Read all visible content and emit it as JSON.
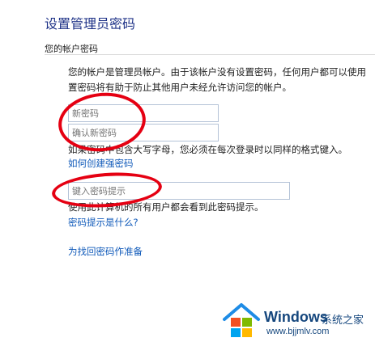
{
  "page": {
    "title": "设置管理员密码",
    "section_label": "您的帐户密码",
    "description": "您的帐户是管理员帐户。由于该帐户没有设置密码，任何用户都可以使用置密码将有助于防止其他用户未经允许访问您的帐户。"
  },
  "form": {
    "new_password_placeholder": "新密码",
    "confirm_password_placeholder": "确认新密码",
    "case_note": "如果密码中包含大写字母，您必须在每次登录时以同样的格式键入。",
    "strong_password_link": "如何创建强密码",
    "hint_placeholder": "键入密码提示",
    "hint_note": "使用此计算机的所有用户都会看到此密码提示。",
    "hint_link": "密码提示是什么?",
    "reset_link": "为找回密码作准备"
  },
  "watermark": {
    "brand": "Windows",
    "brand_cn": "系统之家",
    "url": "www.bjjmlv.com"
  },
  "colors": {
    "title": "#1e3287",
    "link": "#0f59b9",
    "annotation": "#e50012",
    "watermark": "#14467d"
  },
  "icons": {
    "watermark_logo": "house-windows-logo-icon"
  }
}
